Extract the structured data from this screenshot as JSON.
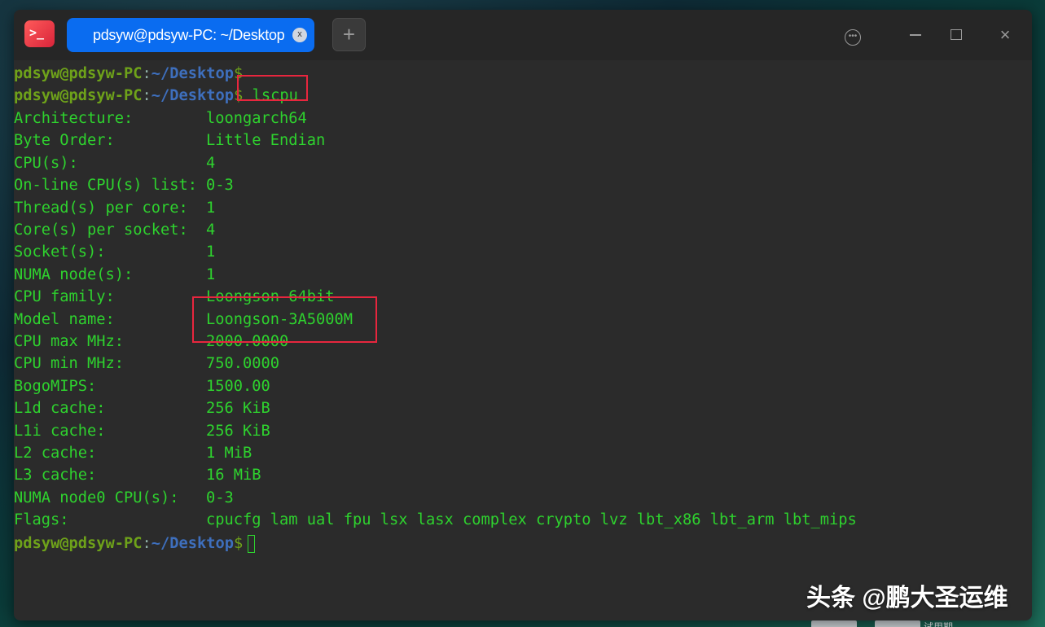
{
  "window": {
    "tab_title": "pdsyw@pdsyw-PC: ~/Desktop",
    "tab_close": "x",
    "new_tab": "+",
    "close_symbol": "×"
  },
  "terminal": {
    "prompt": {
      "user": "pdsyw@pdsyw-PC",
      "colon": ":",
      "path": "~/Desktop",
      "dollar": "$"
    },
    "command": " lscpu",
    "rows": [
      {
        "key": "Architecture:",
        "value": "loongarch64"
      },
      {
        "key": "Byte Order:",
        "value": "Little Endian"
      },
      {
        "key": "CPU(s):",
        "value": "4"
      },
      {
        "key": "On-line CPU(s) list:",
        "value": "0-3"
      },
      {
        "key": "Thread(s) per core:",
        "value": "1"
      },
      {
        "key": "Core(s) per socket:",
        "value": "4"
      },
      {
        "key": "Socket(s):",
        "value": "1"
      },
      {
        "key": "NUMA node(s):",
        "value": "1"
      },
      {
        "key": "CPU family:",
        "value": "Loongson-64bit"
      },
      {
        "key": "Model name:",
        "value": "Loongson-3A5000M"
      },
      {
        "key": "CPU max MHz:",
        "value": "2000.0000"
      },
      {
        "key": "CPU min MHz:",
        "value": "750.0000"
      },
      {
        "key": "BogoMIPS:",
        "value": "1500.00"
      },
      {
        "key": "L1d cache:",
        "value": "256 KiB"
      },
      {
        "key": "L1i cache:",
        "value": "256 KiB"
      },
      {
        "key": "L2 cache:",
        "value": "1 MiB"
      },
      {
        "key": "L3 cache:",
        "value": "16 MiB"
      },
      {
        "key": "NUMA node0 CPU(s):",
        "value": "0-3"
      },
      {
        "key": "Flags:",
        "value": "cpucfg lam ual fpu lsx lasx complex crypto lvz lbt_x86 lbt_arm lbt_mips"
      }
    ]
  },
  "watermark": "头条 @鹏大圣运维",
  "taskbar": {
    "label": "试用期"
  },
  "colors": {
    "terminal_green": "#2ed22e",
    "prompt_user": "#6ea21a",
    "prompt_path": "#3e6fbd",
    "tab_blue": "#0a6cf0",
    "highlight_red": "#e8263e"
  }
}
